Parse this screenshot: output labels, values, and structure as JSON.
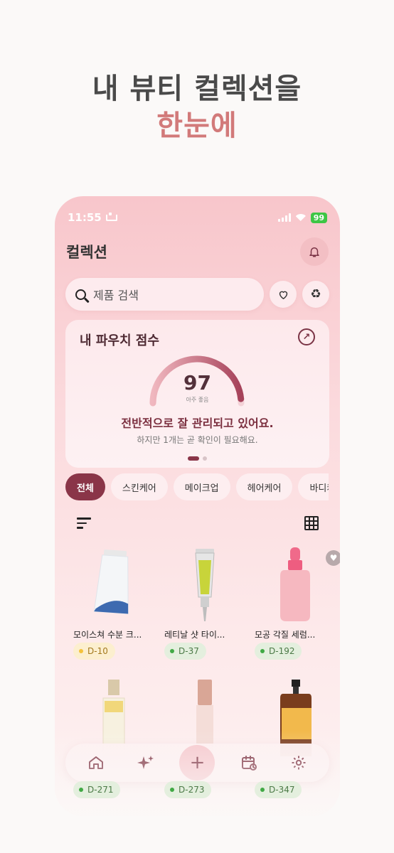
{
  "headline": {
    "line1": "내 뷰티 컬렉션을",
    "line2": "한눈에"
  },
  "status_bar": {
    "time": "11:55",
    "battery": "99"
  },
  "app_bar": {
    "title": "컬렉션",
    "notification_icon": "bell-icon"
  },
  "search": {
    "placeholder": "제품 검색",
    "favorites_icon": "heart-icon",
    "recycle_icon": "recycle-icon"
  },
  "score_card": {
    "title": "내 파우치 점수",
    "score": "97",
    "score_label": "아주 좋음",
    "score_fraction": 0.97,
    "message": "전반적으로 잘 관리되고 있어요.",
    "note": "하지만 1개는 곧 확인이 필요해요.",
    "page_count": 2,
    "active_page": 1
  },
  "categories": [
    {
      "label": "전체",
      "active": true
    },
    {
      "label": "스킨케어",
      "active": false
    },
    {
      "label": "메이크업",
      "active": false
    },
    {
      "label": "헤어케어",
      "active": false
    },
    {
      "label": "바디케어",
      "active": false
    }
  ],
  "products": [
    {
      "name": "모이스쳐 수분 크...",
      "dday": "D-10",
      "status": "warn",
      "favorite": false
    },
    {
      "name": "레티날 샷 타이...",
      "dday": "D-37",
      "status": "ok",
      "favorite": false
    },
    {
      "name": "모공 각질 세럼...",
      "dday": "D-192",
      "status": "ok",
      "favorite": true
    },
    {
      "name": "",
      "dday": "D-271",
      "status": "ok",
      "favorite": false
    },
    {
      "name": "",
      "dday": "D-273",
      "status": "ok",
      "favorite": false
    },
    {
      "name": "",
      "dday": "D-347",
      "status": "ok",
      "favorite": false
    }
  ],
  "nav": {
    "items": [
      "home-icon",
      "sparkle-icon",
      "add-icon",
      "calendar-icon",
      "settings-icon"
    ],
    "add_label": "+"
  },
  "colors": {
    "accent": "#8a3548",
    "headline_accent": "#d27a7a",
    "warn": "#f4c23b",
    "ok": "#41a945"
  }
}
